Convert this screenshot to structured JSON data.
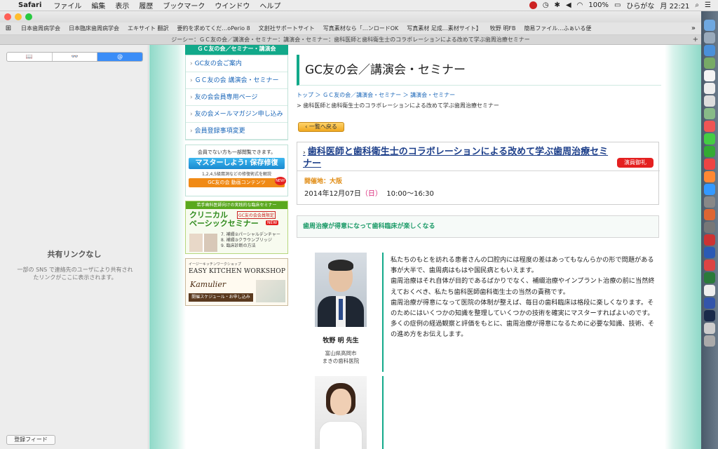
{
  "menubar": {
    "app": "Safari",
    "menus": [
      "ファイル",
      "編集",
      "表示",
      "履歴",
      "ブックマーク",
      "ウインドウ",
      "ヘルプ"
    ],
    "battery": "100%",
    "ime": "ひらがな",
    "clock": "月 22:21"
  },
  "bookmarks": [
    "日本歯周病学会",
    "日本臨床歯周病学会",
    "エキサイト 翻訳",
    "要約を求めてくだ…oPerio 8",
    "文創社サポートサイト",
    "写真素材なら「…ンロードOK",
    "写真素材 足成…素材サイト】",
    "牧野 明FB",
    "簡易ファイル…ふぁいる便"
  ],
  "tab_title": "ジーシー：ＧＣ友の会／講演会・セミナー：講演会・セミナー：歯科医師と歯科衛生士のコラボレーションによる改めて学ぶ歯周治療セミナー",
  "sidebar": {
    "tab_book": "📖",
    "tab_glasses": "👓",
    "tab_at": "@",
    "empty_title": "共有リンクなし",
    "empty_desc": "一部の SNS で連絡先のユーザにより共有されたリンクがここに表示されます。",
    "feed_button": "登録フィード"
  },
  "nav": {
    "header": "ＧＣ友の会／セミナー・講演会",
    "items": [
      "GC友の会ご案内",
      "ＧＣ友の会 講演会・セミナー",
      "友の会会員専用ページ",
      "友の会メールマガジン申し込み",
      "会員登録事項変更"
    ]
  },
  "member_box": {
    "note": "会員でない方も一部閲覧できます。",
    "headline": "マスターしよう! 保存修復Basic",
    "sub": "1,2,4,5級窩洞などの修復術式を解説",
    "footer": "GC友の会 動画コンテンツ",
    "new": "NEW!"
  },
  "clinical_banner": {
    "top": "若手歯科医師向けの実践的な臨床セミナー",
    "title_line1": "クリニカル",
    "title_line2": "ベーシックセミナー",
    "gc_tag": "GC友の会会員限定",
    "new": "NEW",
    "items": [
      "7. 補綴②パーシャルデンチャー",
      "8. 補綴③クラウンブリッジ",
      "9. 臨床診断の方法"
    ]
  },
  "kitchen_banner": {
    "small": "イージーキッチンワークショップ",
    "title": "EASY KITCHEN WORKSHOP",
    "brand": "Kamulier",
    "schedule": "開催スケジュール・お申し込み"
  },
  "page": {
    "title": "GC友の会／講演会・セミナー",
    "breadcrumb": "トップ ＞ ＧＣ友の会／講演会・セミナー ＞ 講演会・セミナー",
    "breadcrumb_current": "> 歯科医師と歯科衛生士のコラボレーションによる改めて学ぶ歯周治療セミナー",
    "back_button": "‹ 一覧へ戻る",
    "event_title": "歯科医師と歯科衛生士のコラボレーションによる改めて学ぶ歯周治療セミナー",
    "badge": "演員御礼",
    "location": "開催地：大阪",
    "date_prefix": "2014年12月07日",
    "date_dow": "（日）",
    "time": "10:00〜16:30",
    "subtitle": "歯周治療が得意になって歯科臨床が楽しくなる",
    "speaker_name": "牧野 明 先生",
    "speaker_aff1": "富山県高岡市",
    "speaker_aff2": "まきの歯科医院",
    "body": [
      "私たちのもとを訪れる患者さんの口腔内には程度の差はあってもなんらかの形で問題がある事が大半で、歯周病はもはや国民病ともいえます。",
      "歯周治療はそれ自体が目的であるばかりでなく、補綴治療やインプラント治療の前に当然終えておくべき、私たち歯科医師歯科衛生士の当然の責務です。",
      "歯周治療が得意になって医院の体制が整えば、毎日の歯科臨床は格段に楽しくなります。そのためにはいくつかの知識を整理していくつかの技術を確実にマスターすればよいのです。多くの症例の経過観察と評価をもとに、歯周治療が得意になるために必要な知識、技術、その進め方をお伝えします。"
    ]
  },
  "colors": {
    "accent": "#12a98a",
    "link": "#1a66b8",
    "badge_red": "#e42020"
  }
}
